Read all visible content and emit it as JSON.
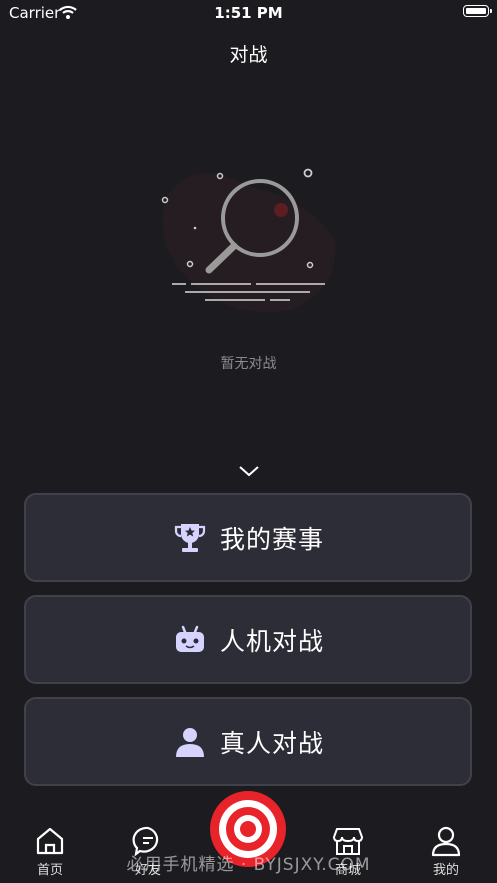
{
  "status_bar": {
    "carrier": "Carrier",
    "time": "1:51 PM"
  },
  "nav": {
    "title": "对战"
  },
  "empty_state": {
    "text": "暂无对战",
    "icon": "magnifier-icon"
  },
  "menu": [
    {
      "label": "我的赛事",
      "icon": "trophy-icon"
    },
    {
      "label": "人机对战",
      "icon": "robot-icon"
    },
    {
      "label": "真人对战",
      "icon": "person-icon"
    }
  ],
  "tabs": [
    {
      "label": "首页",
      "icon": "home-icon"
    },
    {
      "label": "好友",
      "icon": "chat-icon"
    },
    {
      "label": "商城",
      "icon": "store-icon"
    },
    {
      "label": "我的",
      "icon": "profile-icon"
    }
  ],
  "center_button": {
    "icon": "target-icon"
  },
  "watermark": "必用手机精选 · BYJSJXY.COM",
  "colors": {
    "background": "#1c1c20",
    "card": "#2c2d36",
    "accent_red": "#e8232a",
    "icon_tint": "#d6d4ff"
  }
}
